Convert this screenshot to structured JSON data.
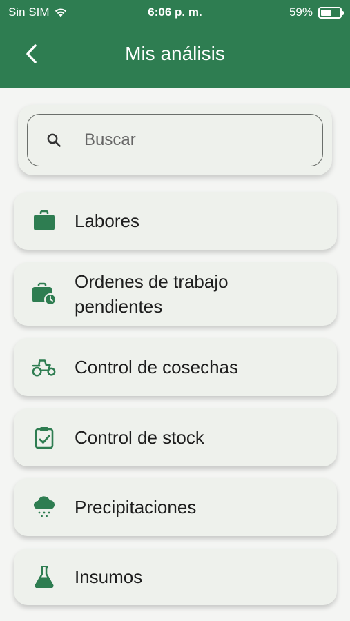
{
  "status_bar": {
    "carrier": "Sin SIM",
    "time": "6:06 p. m.",
    "battery_percent": "59%",
    "battery_level": 0.59
  },
  "header": {
    "title": "Mis análisis",
    "back_icon": "chevron-left-icon"
  },
  "search": {
    "placeholder": "Buscar",
    "value": "",
    "icon": "search-icon"
  },
  "menu": {
    "items": [
      {
        "label": "Labores",
        "icon": "briefcase-icon"
      },
      {
        "label": "Ordenes de trabajo\npendientes",
        "icon": "briefcase-clock-icon"
      },
      {
        "label": "Control de cosechas",
        "icon": "tractor-icon"
      },
      {
        "label": "Control de stock",
        "icon": "clipboard-check-icon"
      },
      {
        "label": "Precipitaciones",
        "icon": "rain-cloud-icon"
      },
      {
        "label": "Insumos",
        "icon": "flask-icon"
      }
    ]
  },
  "colors": {
    "primary": "#2e7d51",
    "card": "#eef1ec",
    "background": "#f4f5f3"
  }
}
